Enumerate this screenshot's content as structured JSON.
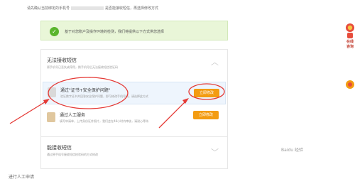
{
  "intro": {
    "prefix": "请先确认当前绑定的手机号",
    "suffix": "是否能接收短信，再选择修改方式"
  },
  "notice": {
    "text": "基于对您账户及操作环境的检测，我们将提供以下方式供您选择"
  },
  "section_unable": {
    "title": "无法接收短信",
    "subtitle": "原手机号已丢失或停用，换手机号后无法接收短信验证码",
    "options": [
      {
        "title": "通过\"证书+安全保护问题\"",
        "description": "验证数字证书并回答安全保护问题，即可修改手机号码，请选择此方式",
        "button": "立即修改"
      },
      {
        "title": "通过人工服务",
        "description": "填写申请单，上传身份证件照片，我们会在48小时内审核，请耐心等待",
        "button": "立即修改"
      }
    ]
  },
  "section_able": {
    "title": "能接收短信",
    "subtitle": "通过原手机号接收短信校验码的方式修改"
  },
  "side_ad": {
    "text": "在线咨询"
  },
  "watermark": {
    "text": "Baidu 经验"
  },
  "bottom_caption": {
    "text": "进行人工申请"
  },
  "colors": {
    "accent": "#f39c12",
    "annotation": "#e53935",
    "notice_bg": "#e9f6d8",
    "check": "#5ab52c"
  },
  "icons": {
    "notice": "check-circle-icon",
    "collapse": "chevron-up-icon",
    "expand": "chevron-down-icon",
    "option1": "certificate-icon",
    "option2": "person-service-icon"
  }
}
